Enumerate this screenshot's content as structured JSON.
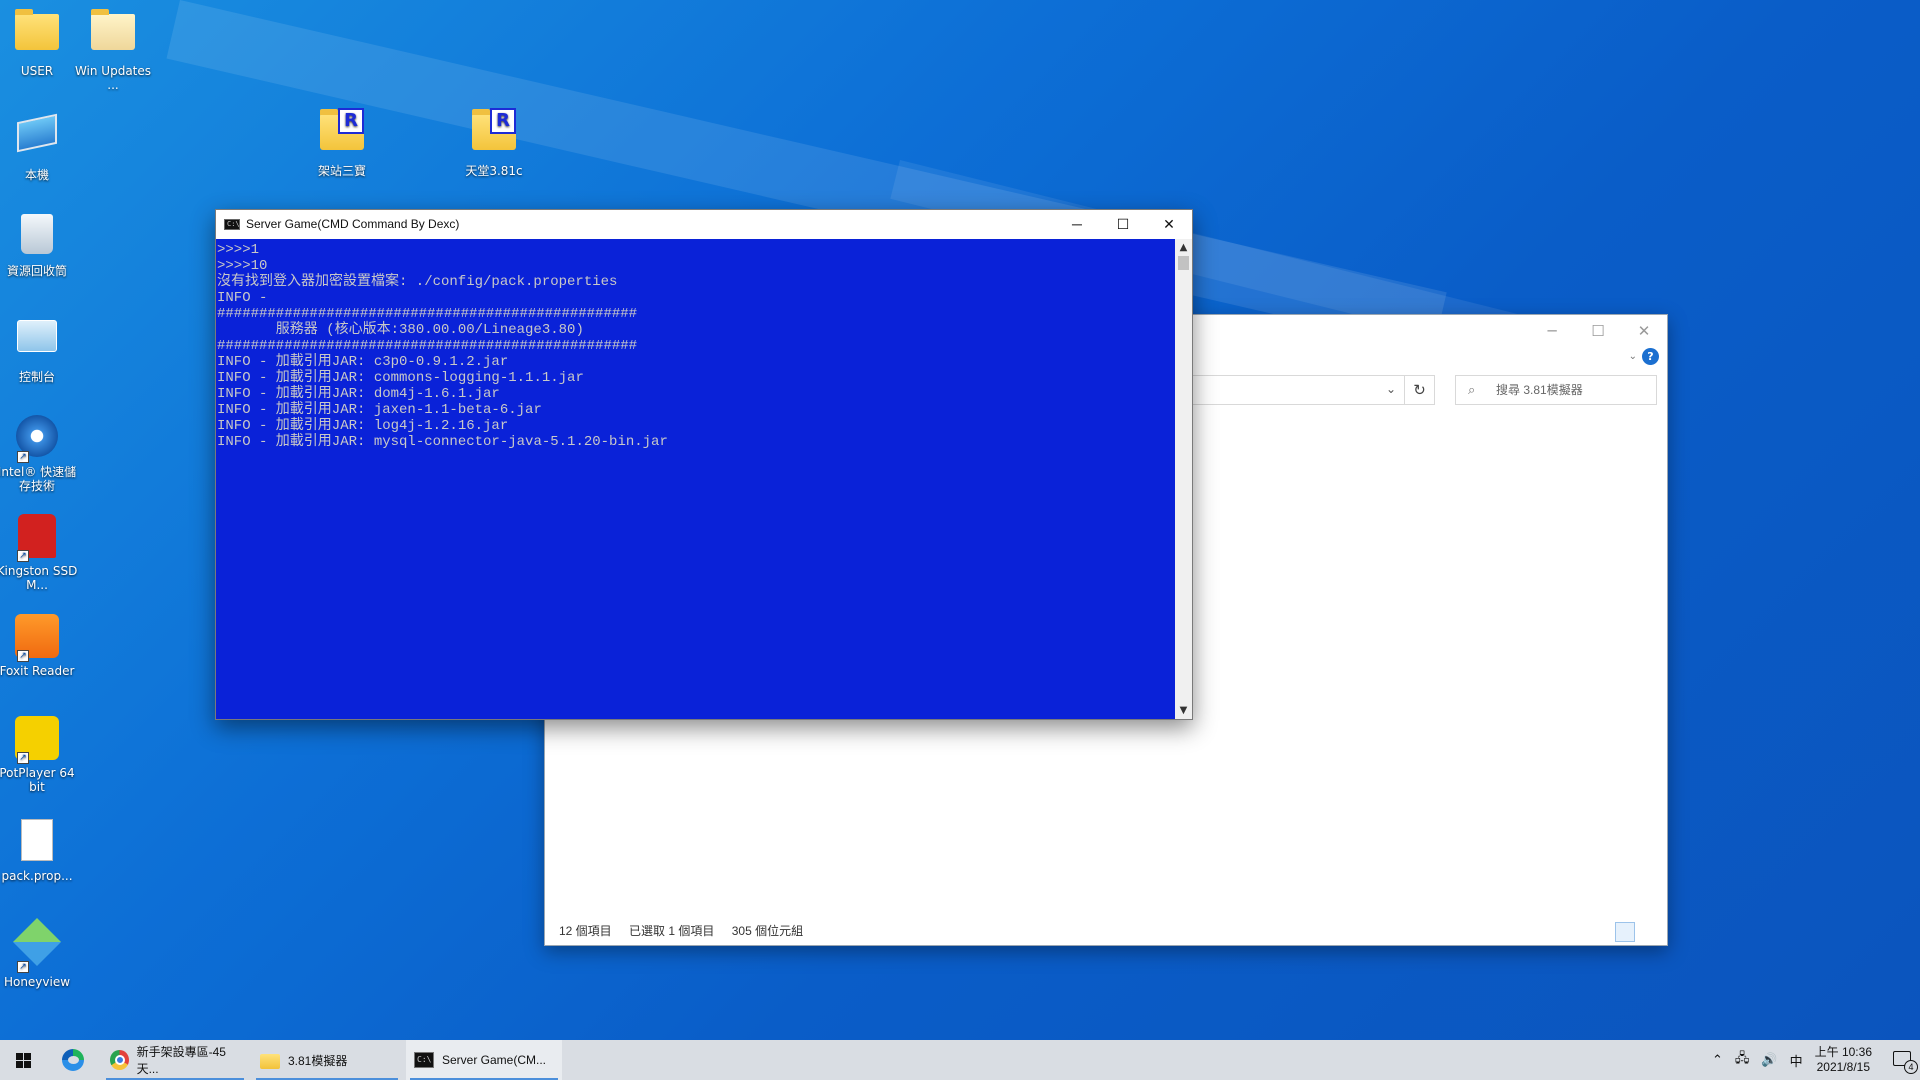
{
  "desktop": {
    "icons": [
      {
        "label": "USER",
        "icon": "user-folder-icon"
      },
      {
        "label": "Win Updates ...",
        "icon": "folder-icon"
      },
      {
        "label": "本機",
        "icon": "computer-icon"
      },
      {
        "label": "資源回收筒",
        "icon": "recycle-bin-icon"
      },
      {
        "label": "控制台",
        "icon": "control-panel-icon"
      },
      {
        "label": "Intel® 快速儲存技術",
        "icon": "intel-rst-icon"
      },
      {
        "label": "Kingston SSD M...",
        "icon": "kingston-icon"
      },
      {
        "label": "Foxit Reader",
        "icon": "foxit-icon"
      },
      {
        "label": "PotPlayer 64 bit",
        "icon": "potplayer-icon"
      },
      {
        "label": "pack.prop...",
        "icon": "text-file-icon"
      },
      {
        "label": "Honeyview",
        "icon": "honeyview-icon"
      },
      {
        "label": "架站三寶",
        "icon": "r-folder-icon"
      },
      {
        "label": "天堂3.81c",
        "icon": "r-folder-icon"
      }
    ]
  },
  "cmd_window": {
    "title": "Server Game(CMD Command By Dexc)",
    "lines": [
      ">>>>1",
      ">>>>10",
      "沒有找到登入器加密設置檔案: ./config/pack.properties",
      "INFO -",
      "##################################################",
      "       服務器 (核心版本:380.00.00/Lineage3.80)",
      "##################################################",
      "INFO - 加載引用JAR: c3p0-0.9.1.2.jar",
      "INFO - 加載引用JAR: commons-logging-1.1.1.jar",
      "INFO - 加載引用JAR: dom4j-1.6.1.jar",
      "INFO - 加載引用JAR: jaxen-1.1-beta-6.jar",
      "INFO - 加載引用JAR: log4j-1.2.16.jar",
      "INFO - 加載引用JAR: mysql-connector-java-5.1.20-bin.jar"
    ],
    "colors": {
      "background": "#0a22d8",
      "text": "#c8c8c8"
    }
  },
  "explorer_window": {
    "search_placeholder": "搜尋 3.81模擬器",
    "status": {
      "item_count": "12 個項目",
      "selected": "已選取 1 個項目",
      "size": "305 個位元組"
    }
  },
  "taskbar": {
    "tasks": [
      {
        "label": "新手架設專區-45天...",
        "icon": "chrome-icon"
      },
      {
        "label": "3.81模擬器",
        "icon": "folder-icon"
      },
      {
        "label": "Server Game(CM...",
        "icon": "cmd-icon"
      }
    ],
    "tray": {
      "ime": "中",
      "time": "上午 10:36",
      "date": "2021/8/15",
      "notification_count": "4"
    }
  }
}
